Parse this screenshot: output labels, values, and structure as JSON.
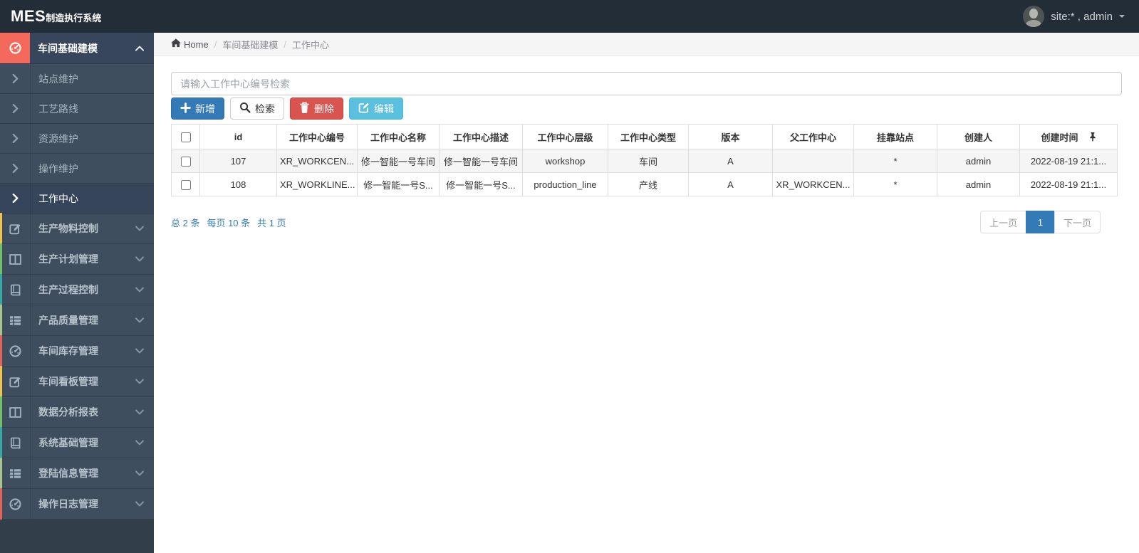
{
  "topbar": {
    "logo_primary": "MES",
    "logo_secondary": "制造执行系统",
    "user_label": "site:* , admin"
  },
  "breadcrumb": {
    "home_label": "Home",
    "items": [
      "车间基础建模",
      "工作中心"
    ]
  },
  "sidebar": {
    "active_group": {
      "label": "车间基础建模",
      "icon": "gauge",
      "accent_color": "#f4695c"
    },
    "sub_items": [
      "站点维护",
      "工艺路线",
      "资源维护",
      "操作维护",
      "工作中心"
    ],
    "active_sub_index": 4,
    "groups": [
      {
        "label": "生产物料控制",
        "icon": "pencil-square",
        "strip": "#eec34d"
      },
      {
        "label": "生产计划管理",
        "icon": "columns",
        "strip": "#72bf6a"
      },
      {
        "label": "生产过程控制",
        "icon": "book",
        "strip": "#38a8a2"
      },
      {
        "label": "产品质量管理",
        "icon": "list",
        "strip": "#a9c48f"
      },
      {
        "label": "车间库存管理",
        "icon": "gauge",
        "strip": "#e4645c"
      },
      {
        "label": "车间看板管理",
        "icon": "pencil-square",
        "strip": "#eec34d"
      },
      {
        "label": "数据分析报表",
        "icon": "columns",
        "strip": "#72bf6a"
      },
      {
        "label": "系统基础管理",
        "icon": "book",
        "strip": "#38a8a2"
      },
      {
        "label": "登陆信息管理",
        "icon": "list",
        "strip": "#a9c48f"
      },
      {
        "label": "操作日志管理",
        "icon": "gauge",
        "strip": "#e4645c"
      }
    ]
  },
  "search": {
    "placeholder": "请输入工作中心编号检索"
  },
  "toolbar": {
    "add": "新增",
    "search": "检索",
    "delete": "删除",
    "edit": "编辑"
  },
  "table": {
    "headers": [
      "id",
      "工作中心编号",
      "工作中心名称",
      "工作中心描述",
      "工作中心层级",
      "工作中心类型",
      "版本",
      "父工作中心",
      "挂靠站点",
      "创建人",
      "创建时间"
    ],
    "rows": [
      [
        "107",
        "XR_WORKCEN...",
        "修一智能一号车间",
        "修一智能一号车间",
        "workshop",
        "车间",
        "A",
        "",
        "*",
        "admin",
        "2022-08-19 21:1..."
      ],
      [
        "108",
        "XR_WORKLINE...",
        "修一智能一号S...",
        "修一智能一号S...",
        "production_line",
        "产线",
        "A",
        "XR_WORKCEN...",
        "*",
        "admin",
        "2022-08-19 21:1..."
      ]
    ]
  },
  "pagination": {
    "summary": [
      "总 2 条",
      "每页 10 条",
      "共 1 页"
    ],
    "prev": "上一页",
    "current": "1",
    "next": "下一页"
  },
  "colors": {
    "primary": "#337ab7",
    "danger": "#d9534f",
    "info": "#5bc0de",
    "sidebar_accent": "#f4695c",
    "topbar_bg": "#232d37",
    "sidebar_bg": "#3f4e5e"
  }
}
